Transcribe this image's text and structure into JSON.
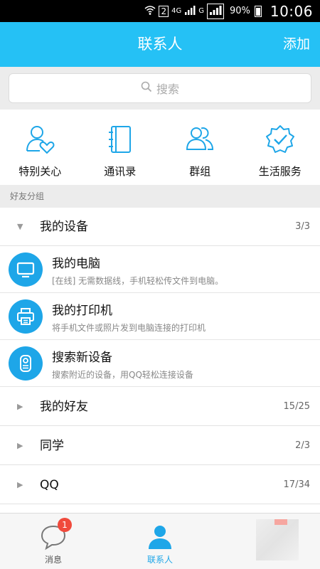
{
  "status_bar": {
    "network_sim": "2",
    "net_4g": "4G",
    "net_g": "G",
    "battery": "90%",
    "time": "10:06"
  },
  "header": {
    "title": "联系人",
    "add_label": "添加"
  },
  "search": {
    "placeholder": "搜索"
  },
  "quick_actions": [
    {
      "label": "特别关心",
      "icon": "special-care-icon"
    },
    {
      "label": "通讯录",
      "icon": "address-book-icon"
    },
    {
      "label": "群组",
      "icon": "group-icon"
    },
    {
      "label": "生活服务",
      "icon": "life-service-icon"
    }
  ],
  "section_header": "好友分组",
  "groups": [
    {
      "name": "我的设备",
      "count": "3/3",
      "expanded": true
    },
    {
      "name": "我的好友",
      "count": "15/25",
      "expanded": false
    },
    {
      "name": "同学",
      "count": "2/3",
      "expanded": false
    },
    {
      "name": "QQ",
      "count": "17/34",
      "expanded": false
    }
  ],
  "devices": [
    {
      "title": "我的电脑",
      "subtitle": "[在线] 无需数据线，手机轻松传文件到电脑。",
      "icon": "computer-icon"
    },
    {
      "title": "我的打印机",
      "subtitle": "将手机文件或照片发到电脑连接的打印机",
      "icon": "printer-icon"
    },
    {
      "title": "搜索新设备",
      "subtitle": "搜索附近的设备，用QQ轻松连接设备",
      "icon": "device-search-icon"
    }
  ],
  "tab_bar": {
    "messages_label": "消息",
    "messages_badge": "1",
    "contacts_label": "联系人"
  },
  "colors": {
    "accent": "#25c1f5",
    "icon_blue": "#1ea6e8",
    "badge_red": "#f04a3c"
  }
}
